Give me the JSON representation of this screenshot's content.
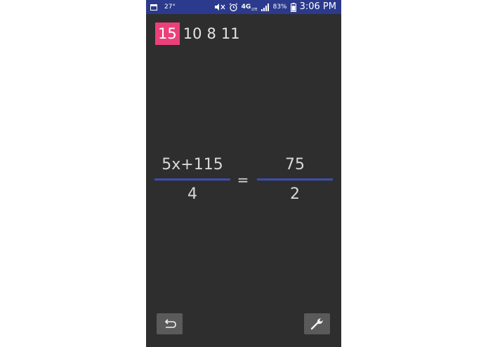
{
  "status_bar": {
    "temperature": "27°",
    "network_label": "4G",
    "network_sub": "LTE",
    "battery_percent": "83%",
    "time": "3:06 PM",
    "icons": [
      "calendar-icon",
      "mute-icon",
      "alarm-icon",
      "signal-icon",
      "battery-icon"
    ]
  },
  "numbers": {
    "items": [
      "15",
      "10",
      "8",
      "11"
    ],
    "selected_index": 0
  },
  "equation": {
    "left": {
      "numerator": "5x+115",
      "denominator": "4"
    },
    "operator": "=",
    "right": {
      "numerator": "75",
      "denominator": "2"
    }
  },
  "buttons": {
    "undo_icon": "undo-icon",
    "settings_icon": "wrench-icon"
  },
  "colors": {
    "status_bar": "#2b3a8c",
    "background": "#2e2e2e",
    "highlight": "#ec407a",
    "fraction_bar": "#3b4fb1",
    "button": "#5a5a5a"
  }
}
